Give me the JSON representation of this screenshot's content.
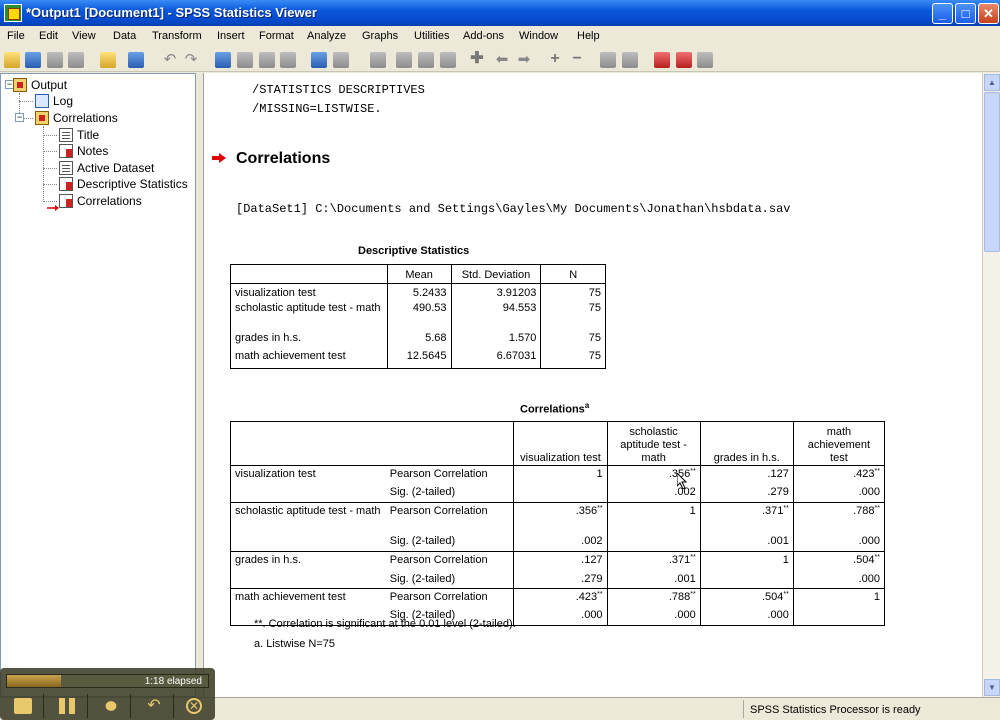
{
  "window": {
    "title": "*Output1 [Document1] - SPSS Statistics Viewer"
  },
  "menu": [
    "File",
    "Edit",
    "View",
    "Data",
    "Transform",
    "Insert",
    "Format",
    "Analyze",
    "Graphs",
    "Utilities",
    "Add-ons",
    "Window",
    "Help"
  ],
  "outline": {
    "root": "Output",
    "log": "Log",
    "correlations": "Correlations",
    "children": [
      "Title",
      "Notes",
      "Active Dataset",
      "Descriptive Statistics",
      "Correlations"
    ]
  },
  "syntax": {
    "line1": "/STATISTICS DESCRIPTIVES",
    "line2": "/MISSING=LISTWISE."
  },
  "heading": "Correlations",
  "dataset": "[DataSet1] C:\\Documents and Settings\\Gayles\\My Documents\\Jonathan\\hsbdata.sav",
  "descriptives": {
    "title": "Descriptive Statistics",
    "headers": [
      "Mean",
      "Std. Deviation",
      "N"
    ],
    "rows": [
      {
        "label": "visualization test",
        "mean": "5.2433",
        "sd": "3.91203",
        "n": "75"
      },
      {
        "label": "scholastic aptitude test - math",
        "mean": "490.53",
        "sd": "94.553",
        "n": "75"
      },
      {
        "label": "grades in h.s.",
        "mean": "5.68",
        "sd": "1.570",
        "n": "75"
      },
      {
        "label": "math achievement test",
        "mean": "12.5645",
        "sd": "6.67031",
        "n": "75"
      }
    ]
  },
  "correlations": {
    "title": "Correlations",
    "title_sup": "a",
    "col_headers": [
      "visualization test",
      "scholastic aptitude test - math",
      "grades in h.s.",
      "math achievement test"
    ],
    "row_stat1": "Pearson Correlation",
    "row_stat2": "Sig. (2-tailed)",
    "star": "**",
    "rows": [
      {
        "label": "visualization test",
        "r": [
          "1",
          ".356",
          ".127",
          ".423"
        ],
        "rs": [
          "",
          "**",
          "",
          "**"
        ],
        "p": [
          "",
          ".002",
          ".279",
          ".000"
        ]
      },
      {
        "label": "scholastic aptitude test - math",
        "r": [
          ".356",
          "1",
          ".371",
          ".788"
        ],
        "rs": [
          "**",
          "",
          "**",
          "**"
        ],
        "p": [
          ".002",
          "",
          ".001",
          ".000"
        ]
      },
      {
        "label": "grades in h.s.",
        "r": [
          ".127",
          ".371",
          "1",
          ".504"
        ],
        "rs": [
          "",
          "**",
          "",
          "**"
        ],
        "p": [
          ".279",
          ".001",
          "",
          ".000"
        ]
      },
      {
        "label": "math achievement test",
        "r": [
          ".423",
          ".788",
          ".504",
          "1"
        ],
        "rs": [
          "**",
          "**",
          "**",
          ""
        ],
        "p": [
          ".000",
          ".000",
          ".000",
          ""
        ]
      }
    ],
    "footnote1": "**. Correlation is significant at the 0.01 level (2-tailed).",
    "footnote2": "a. Listwise N=75"
  },
  "status": "SPSS Statistics  Processor is ready",
  "recorder": {
    "elapsed": "1:18 elapsed",
    "progress": 0.27
  },
  "colors": {
    "titlebar": "#0a58dc",
    "accent_red": "#e00000",
    "recorder": "#3c3c28"
  }
}
